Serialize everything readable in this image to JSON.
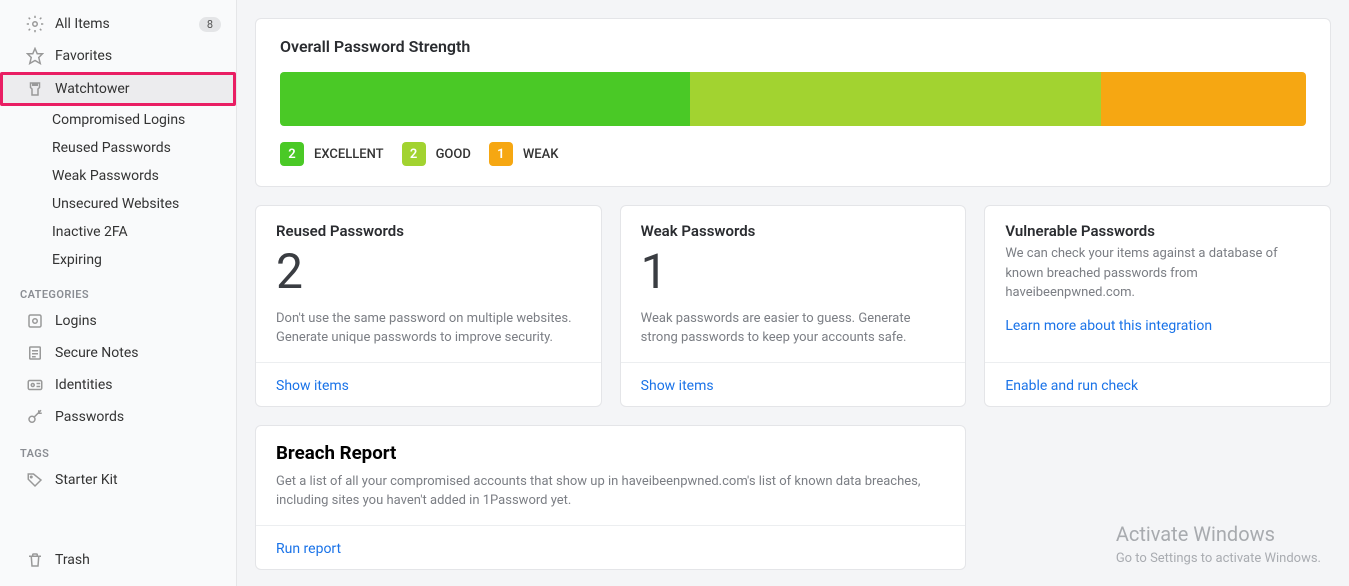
{
  "sidebar": {
    "allItems": {
      "label": "All Items",
      "badge": "8"
    },
    "favorites": {
      "label": "Favorites"
    },
    "watchtower": {
      "label": "Watchtower"
    },
    "watchtowerSub": [
      {
        "label": "Compromised Logins"
      },
      {
        "label": "Reused Passwords"
      },
      {
        "label": "Weak Passwords"
      },
      {
        "label": "Unsecured Websites"
      },
      {
        "label": "Inactive 2FA"
      },
      {
        "label": "Expiring"
      }
    ],
    "categoriesHeading": "CATEGORIES",
    "categories": [
      {
        "label": "Logins"
      },
      {
        "label": "Secure Notes"
      },
      {
        "label": "Identities"
      },
      {
        "label": "Passwords"
      }
    ],
    "tagsHeading": "TAGS",
    "tags": [
      {
        "label": "Starter Kit"
      }
    ],
    "trash": {
      "label": "Trash"
    }
  },
  "strength": {
    "title": "Overall Password Strength",
    "segments": [
      {
        "count": "2",
        "label": "EXCELLENT",
        "pct": 40,
        "color": "green"
      },
      {
        "count": "2",
        "label": "GOOD",
        "pct": 40,
        "color": "lightgreen"
      },
      {
        "count": "1",
        "label": "WEAK",
        "pct": 20,
        "color": "orange"
      }
    ]
  },
  "cards": {
    "reused": {
      "title": "Reused Passwords",
      "count": "2",
      "desc": "Don't use the same password on multiple websites. Generate unique passwords to improve security.",
      "action": "Show items"
    },
    "weak": {
      "title": "Weak Passwords",
      "count": "1",
      "desc": "Weak passwords are easier to guess. Generate strong passwords to keep your accounts safe.",
      "action": "Show items"
    },
    "vulnerable": {
      "title": "Vulnerable Passwords",
      "desc": "We can check your items against a database of known breached passwords from haveibeenpwned.com.",
      "learn": "Learn more about this integration",
      "action": "Enable and run check"
    }
  },
  "breach": {
    "title": "Breach Report",
    "desc": "Get a list of all your compromised accounts that show up in haveibeenpwned.com's list of known data breaches, including sites you haven't added in 1Password yet.",
    "action": "Run report"
  },
  "watermark": {
    "title": "Activate Windows",
    "subtitle": "Go to Settings to activate Windows."
  }
}
